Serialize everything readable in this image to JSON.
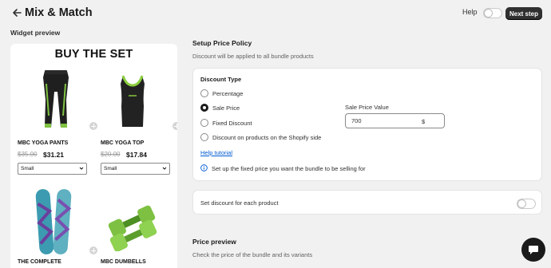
{
  "header": {
    "title": "Mix & Match",
    "help_label": "Help",
    "next_label": "Next step"
  },
  "widget": {
    "label": "Widget preview",
    "set_title": "BUY THE SET",
    "products": [
      {
        "name": "MBC YOGA PANTS",
        "old_price": "$35.00",
        "new_price": "$31.21",
        "variant": "Small",
        "colors": {
          "main": "#1f1f1f",
          "accent": "#7fc241"
        }
      },
      {
        "name": "MBC YOGA TOP",
        "old_price": "$20.00",
        "new_price": "$17.84",
        "variant": "Small",
        "colors": {
          "main": "#222222",
          "accent": "#8ccf3f"
        }
      },
      {
        "name": "THE COMPLETE",
        "colors": {
          "main": "#3c9bb0",
          "accent": "#6b3f9e"
        }
      },
      {
        "name": "MBC DUMBELLS",
        "colors": {
          "main": "#7ec142",
          "accent": "#4d8f22"
        }
      }
    ]
  },
  "setup": {
    "title": "Setup Price Policy",
    "subtitle": "Discount will be applied to all bundle products",
    "discount_type_label": "Discount Type",
    "options": [
      {
        "label": "Percentage",
        "selected": false
      },
      {
        "label": "Sale Price",
        "selected": true
      },
      {
        "label": "Fixed Discount",
        "selected": false
      },
      {
        "label": "Discount on products on the Shopify side",
        "selected": false
      }
    ],
    "sale_price_label": "Sale Price Value",
    "sale_price_value": "700",
    "sale_price_suffix": "$",
    "help_link": "Help tutorial",
    "info_text": "Set up the fixed price you want the bundle to be selling for"
  },
  "per_product": {
    "label": "Set discount for each product",
    "enabled": false
  },
  "price_preview": {
    "title": "Price preview",
    "subtitle": "Check the price of the bundle and its variants"
  },
  "colors": {
    "primary_button": "#303030",
    "link": "#005bd3",
    "background": "#f1f1f1"
  }
}
